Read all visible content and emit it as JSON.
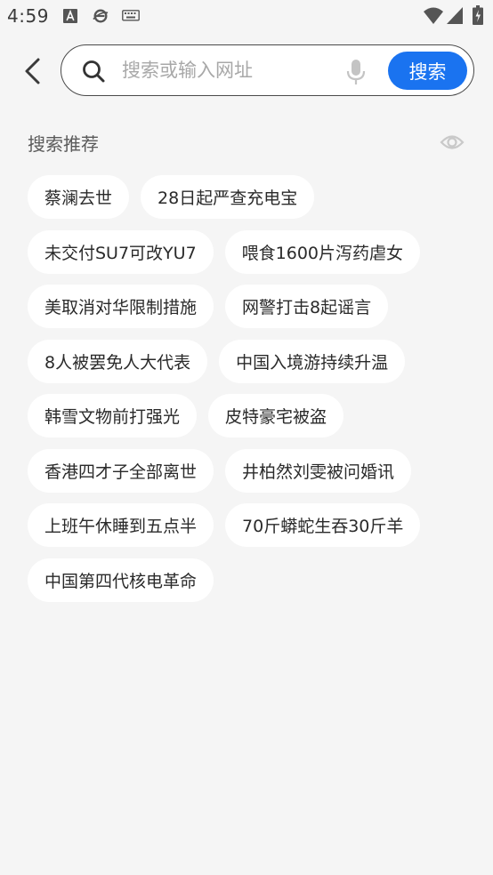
{
  "status_bar": {
    "time": "4:59",
    "icons": [
      "a-box-icon",
      "e-browser-icon",
      "keyboard-icon",
      "wifi-icon",
      "signal-icon",
      "battery-icon"
    ]
  },
  "search": {
    "placeholder": "搜索或输入网址",
    "button_label": "搜索"
  },
  "section": {
    "title": "搜索推荐"
  },
  "chip_rows": [
    [
      "蔡澜去世",
      "28日起严查充电宝"
    ],
    [
      "未交付SU7可改YU7",
      "喂食1600片泻药虐女"
    ],
    [
      "美取消对华限制措施",
      "网警打击8起谣言"
    ],
    [
      "8人被罢免人大代表",
      "中国入境游持续升温"
    ],
    [
      "韩雪文物前打强光",
      "皮特豪宅被盗"
    ],
    [
      "香港四才子全部离世",
      "井柏然刘雯被问婚讯"
    ],
    [
      "上班午休睡到五点半",
      "70斤蟒蛇生吞30斤羊"
    ],
    [
      "中国第四代核电革命"
    ]
  ],
  "colors": {
    "accent": "#1a73f0",
    "background": "#f5f5f5",
    "chip_background": "#ffffff"
  }
}
